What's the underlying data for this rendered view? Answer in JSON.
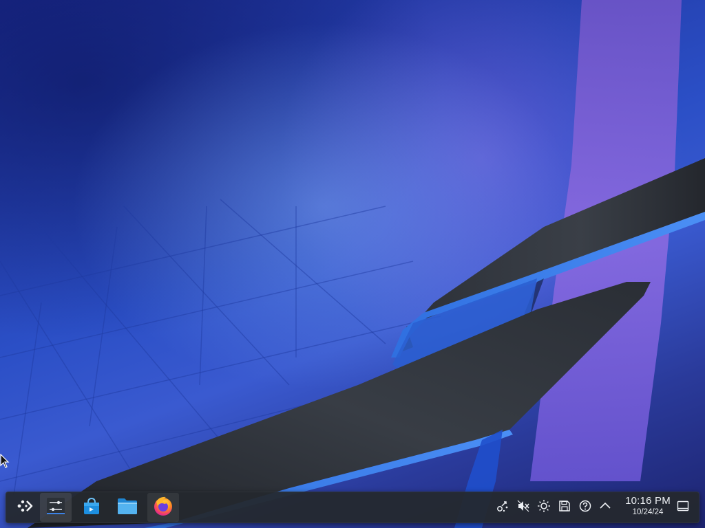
{
  "desktop": {
    "wallpaper": "plasma-wallpaper",
    "accent": "#3b82e6"
  },
  "panel": {
    "launcher": {
      "icon": "application-launcher-icon"
    },
    "pinned": [
      {
        "name": "System Settings",
        "icon": "settings-sliders-icon",
        "active": true
      },
      {
        "name": "Discover",
        "icon": "software-store-icon"
      },
      {
        "name": "Dolphin",
        "icon": "folder-icon"
      },
      {
        "name": "Firefox",
        "icon": "firefox-icon",
        "hover": true
      }
    ],
    "tray": [
      {
        "icon": "network-icon"
      },
      {
        "icon": "volume-muted-icon"
      },
      {
        "icon": "brightness-icon"
      },
      {
        "icon": "disk-save-icon"
      },
      {
        "icon": "help-icon"
      },
      {
        "icon": "chevron-up-icon"
      }
    ],
    "clock": {
      "time": "10:16 PM",
      "date": "10/24/24"
    },
    "show_desktop": {
      "icon": "show-desktop-icon"
    }
  }
}
